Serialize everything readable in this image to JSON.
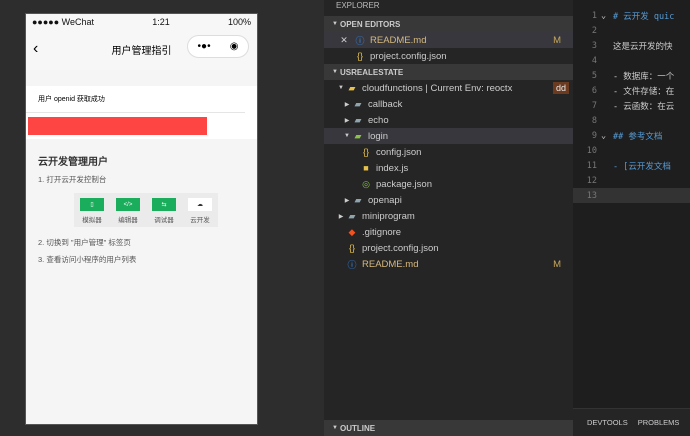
{
  "phone": {
    "carrier": "●●●●● WeChat",
    "time": "1:21",
    "battery": "100%",
    "title": "用户管理指引",
    "openid_msg": "用户 openid 获取成功",
    "heading": "云开发管理用户",
    "step1": "1. 打开云开发控制台",
    "tools": [
      {
        "icon": "▯",
        "label": "模拟器"
      },
      {
        "icon": "</>",
        "label": "编辑器"
      },
      {
        "icon": "⇆",
        "label": "调试器"
      },
      {
        "icon": "☁",
        "label": "云开发"
      }
    ],
    "step2": "2. 切换到 \"用户管理\" 标签页",
    "step3": "3. 查看访问小程序的用户列表"
  },
  "explorer": {
    "title": "EXPLORER",
    "open_editors": "OPEN EDITORS",
    "open": [
      {
        "name": "README.md",
        "status": "M"
      },
      {
        "name": "project.config.json"
      }
    ],
    "project": "USREALESTATE",
    "cloudfunctions": "cloudfunctions | Current Env: reoctx",
    "badge": "dd",
    "folders": [
      "callback",
      "echo"
    ],
    "login": "login",
    "login_files": [
      "config.json",
      "index.js",
      "package.json"
    ],
    "openapi": "openapi",
    "miniprogram": "miniprogram",
    "root_files": [
      ".gitignore",
      "project.config.json",
      "README.md"
    ],
    "readme_status": "M",
    "outline": "OUTLINE"
  },
  "editor": {
    "lines": [
      {
        "n": "1",
        "f": "⌄",
        "t": "# 云开发 quic"
      },
      {
        "n": "2",
        "t": ""
      },
      {
        "n": "3",
        "t": "这是云开发的快"
      },
      {
        "n": "4",
        "t": ""
      },
      {
        "n": "5",
        "t": "- 数据库：一个"
      },
      {
        "n": "6",
        "t": "- 文件存储：在"
      },
      {
        "n": "7",
        "t": "- 云函数：在云"
      },
      {
        "n": "8",
        "t": ""
      },
      {
        "n": "9",
        "f": "⌄",
        "t": "## 参考文档"
      },
      {
        "n": "10",
        "t": ""
      },
      {
        "n": "11",
        "t": "- [云开发文档"
      },
      {
        "n": "12",
        "t": ""
      },
      {
        "n": "13",
        "t": ""
      }
    ]
  },
  "panel": {
    "tabs": [
      "DEVTOOLS",
      "PROBLEMS"
    ]
  }
}
